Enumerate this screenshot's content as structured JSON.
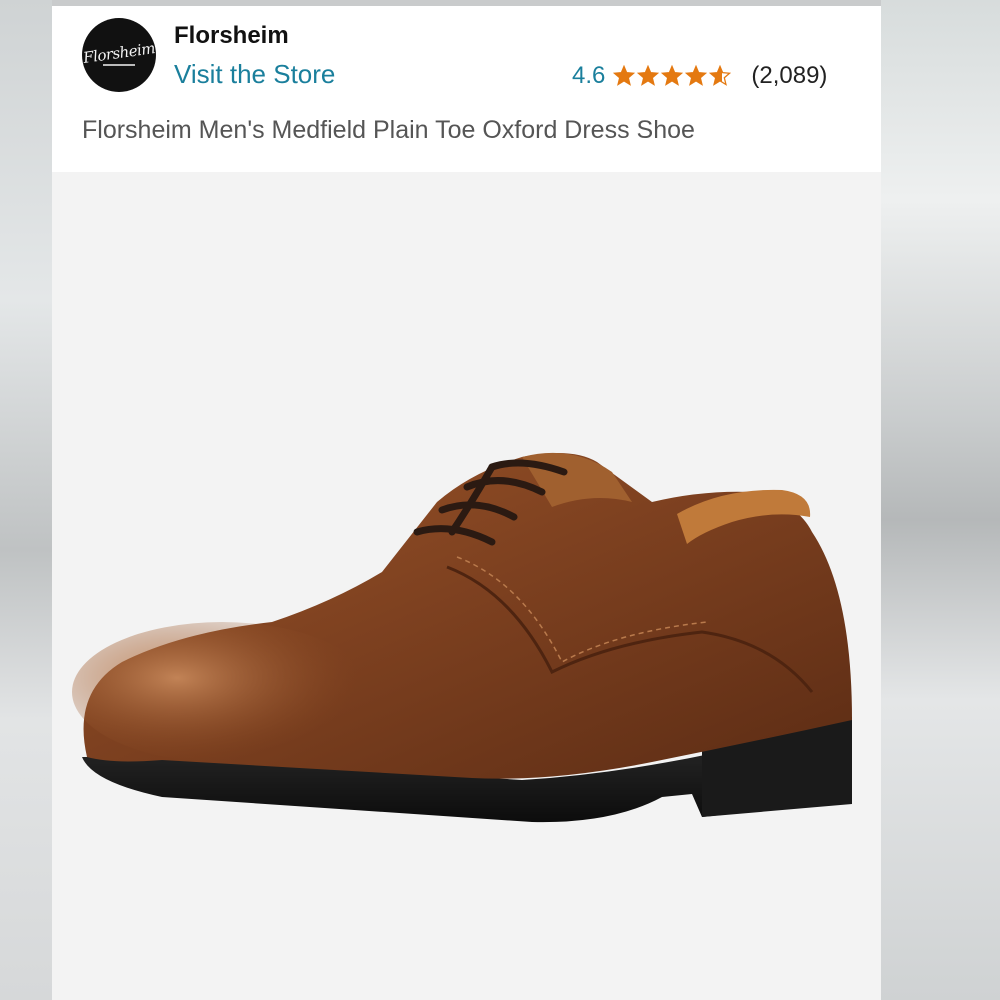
{
  "header": {
    "brand_name": "Florsheim",
    "logo_text": "Florsheim",
    "visit_store_label": "Visit the Store",
    "rating_value": "4.6",
    "stars_value": 4.6,
    "stars_max": 5,
    "review_count": "(2,089)"
  },
  "product": {
    "title": "Florsheim Men's Medfield Plain Toe Oxford Dress Shoe"
  },
  "colors": {
    "link": "#1a7f9c",
    "star": "#e47911",
    "leather": "#8a4a22",
    "sole": "#151515"
  },
  "icons": {
    "star": "star-icon"
  }
}
